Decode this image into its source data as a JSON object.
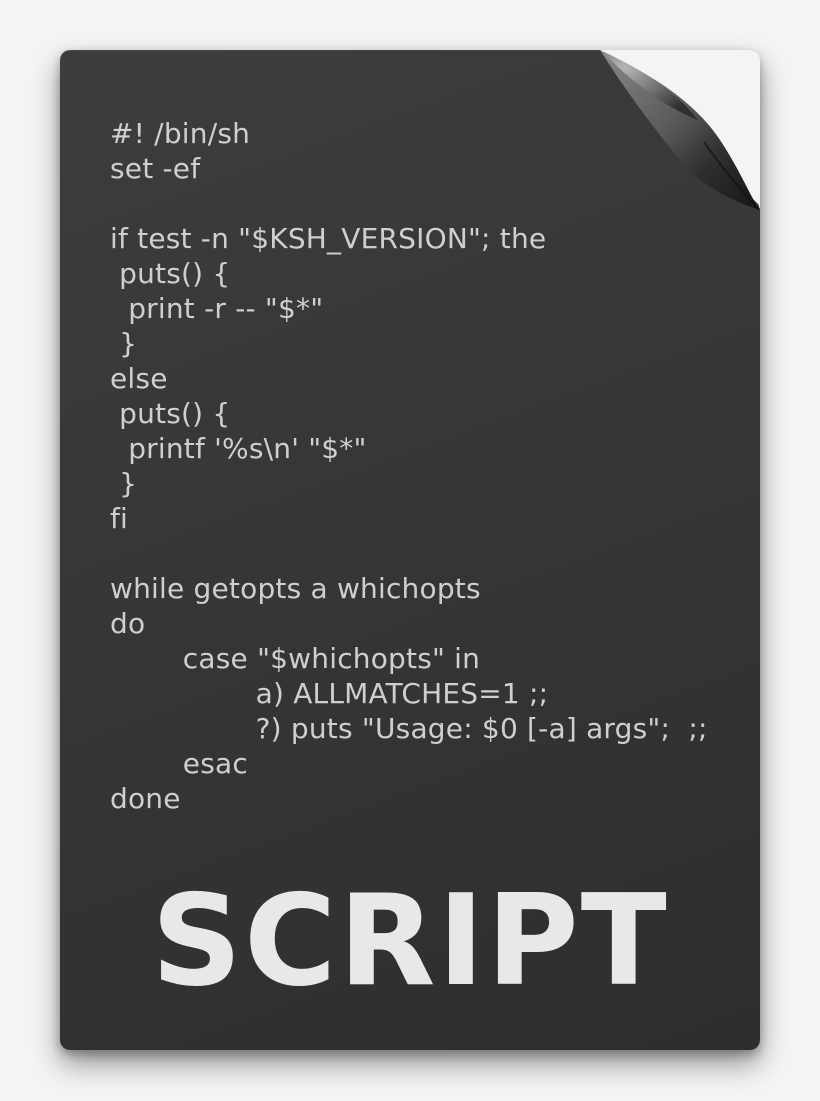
{
  "icon": {
    "title": "SCRIPT",
    "code_lines": [
      "#! /bin/sh",
      "set -ef",
      "",
      "if test -n \"$KSH_VERSION\"; the",
      " puts() {",
      "  print -r -- \"$*\"",
      " }",
      "else",
      " puts() {",
      "  printf '%s\\n' \"$*\"",
      " }",
      "fi",
      "",
      "while getopts a whichopts",
      "do",
      "        case \"$whichopts\" in",
      "                a) ALLMATCHES=1 ;;",
      "                ?) puts \"Usage: $0 [-a] args\";  ;;",
      "        esac",
      "done"
    ]
  }
}
